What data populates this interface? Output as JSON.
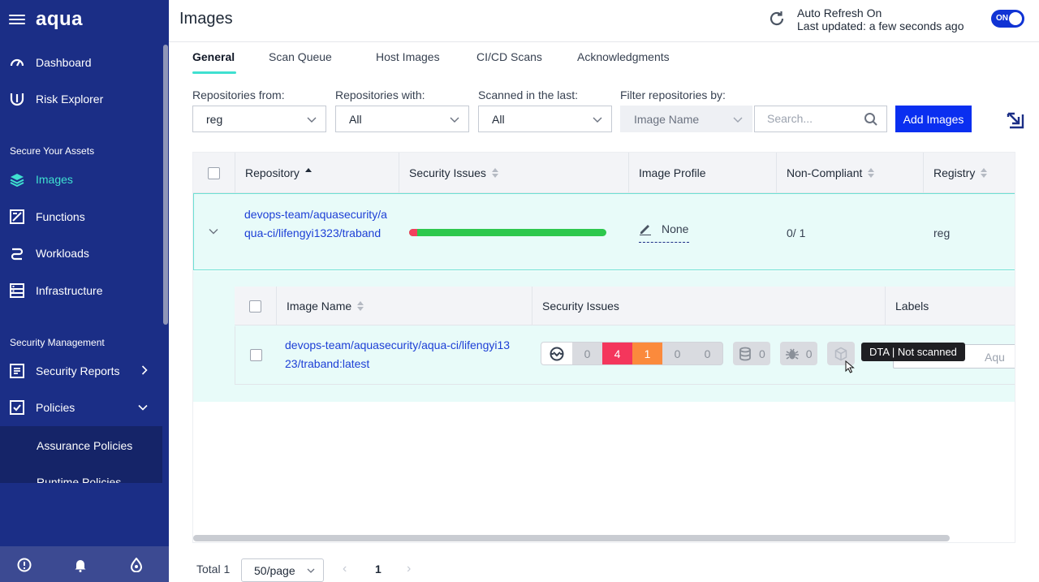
{
  "app": {
    "logo": "aqua"
  },
  "sidebar": {
    "items": [
      {
        "label": "Dashboard",
        "icon": "dashboard-icon"
      },
      {
        "label": "Risk Explorer",
        "icon": "risk-explorer-icon"
      }
    ],
    "section_assets": "Secure Your Assets",
    "asset_items": [
      {
        "label": "Images",
        "icon": "layers-icon",
        "active": true
      },
      {
        "label": "Functions",
        "icon": "functions-icon"
      },
      {
        "label": "Workloads",
        "icon": "workloads-icon"
      },
      {
        "label": "Infrastructure",
        "icon": "infrastructure-icon"
      }
    ],
    "section_security": "Security Management",
    "security_items": [
      {
        "label": "Security Reports",
        "icon": "reports-icon"
      },
      {
        "label": "Policies",
        "icon": "policies-icon"
      }
    ],
    "sub_items": [
      "Assurance Policies",
      "Runtime Policies"
    ],
    "active_color": "#3fe0d0"
  },
  "header": {
    "title": "Images",
    "auto_refresh": "Auto Refresh On",
    "last_updated": "Last updated: a few seconds ago",
    "toggle": "ON"
  },
  "tabs": [
    "General",
    "Scan Queue",
    "Host Images",
    "CI/CD Scans",
    "Acknowledgments"
  ],
  "filters": {
    "repos_from_label": "Repositories from:",
    "repos_from_value": "reg",
    "repos_with_label": "Repositories with:",
    "repos_with_value": "All",
    "scanned_label": "Scanned in the last:",
    "scanned_value": "All",
    "filter_by_label": "Filter repositories by:",
    "filter_by_value": "Image Name",
    "search_placeholder": "Search...",
    "add_button": "Add Images"
  },
  "table": {
    "headers": [
      "Repository",
      "Security Issues",
      "Image Profile",
      "Non-Compliant",
      "Registry"
    ],
    "repo_row": {
      "repository": "devops-team/aquasecurity/aqua-ci/lifengyi1323/traband",
      "security_issues_critical_fraction": 0.04,
      "image_profile": "None",
      "non_compliant": "0/ 1",
      "registry": "reg"
    },
    "sub_headers": [
      "Image Name",
      "Security Issues",
      "Labels"
    ],
    "image_row": {
      "image_name": "devops-team/aquasecurity/aqua-ci/lifengyi1323/traband:latest",
      "vuln_counts": [
        "0",
        "4",
        "1",
        "0",
        "0"
      ],
      "malware": "0",
      "sensitive": "0",
      "label_placeholder": "Aqu"
    }
  },
  "tooltip": "DTA | Not scanned",
  "pagination": {
    "total": "Total 1",
    "page_size": "50/page",
    "current_page": "1"
  },
  "colors": {
    "sidebar_bg": "#1b2e86",
    "primary": "#0a2ff0",
    "critical": "#f4365c",
    "high": "#fb8a3c",
    "ok": "#2dc84d",
    "highlight": "#e8fbf9"
  }
}
